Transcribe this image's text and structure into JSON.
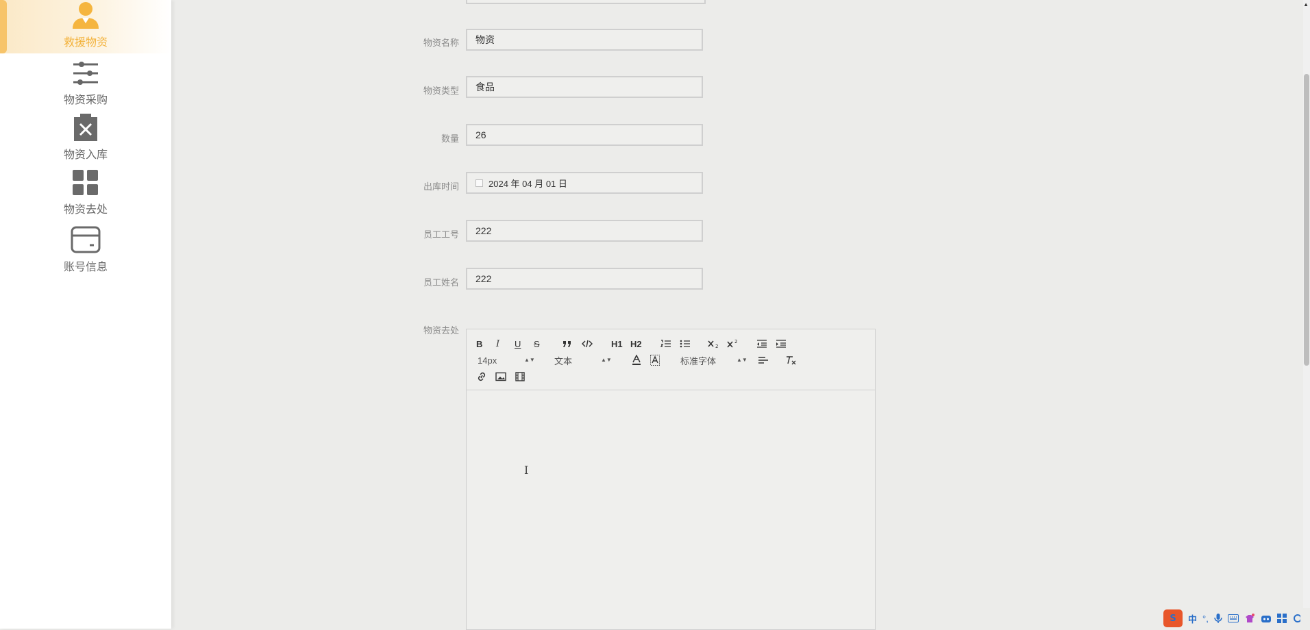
{
  "sidebar": {
    "items": [
      {
        "label": "救援物资",
        "icon": "user-icon",
        "active": true
      },
      {
        "label": "物资采购",
        "icon": "sliders-icon",
        "active": false
      },
      {
        "label": "物资入库",
        "icon": "clipboard-x-icon",
        "active": false
      },
      {
        "label": "物资去处",
        "icon": "grid-icon",
        "active": false
      },
      {
        "label": "账号信息",
        "icon": "card-icon",
        "active": false
      }
    ],
    "accent_color": "#f3b33d"
  },
  "form": {
    "name": {
      "label": "物资名称",
      "value": "物资"
    },
    "type": {
      "label": "物资类型",
      "value": "食品"
    },
    "quantity": {
      "label": "数量",
      "value": "26"
    },
    "out_time": {
      "label": "出库时间",
      "value": "2024 年 04 月 01 日"
    },
    "employee_id": {
      "label": "员工工号",
      "value": "222"
    },
    "employee_name": {
      "label": "员工姓名",
      "value": "222"
    },
    "destination": {
      "label": "物资去处"
    }
  },
  "editor": {
    "toolbar": {
      "bold": "B",
      "italic": "I",
      "underline": "U",
      "strike": "S",
      "h1": "H1",
      "h2": "H2",
      "font_size": "14px",
      "header_select": "文本",
      "font_family": "标准字体"
    },
    "content": ""
  },
  "tray": {
    "ime_logo": "S",
    "ime_mode": "中"
  }
}
